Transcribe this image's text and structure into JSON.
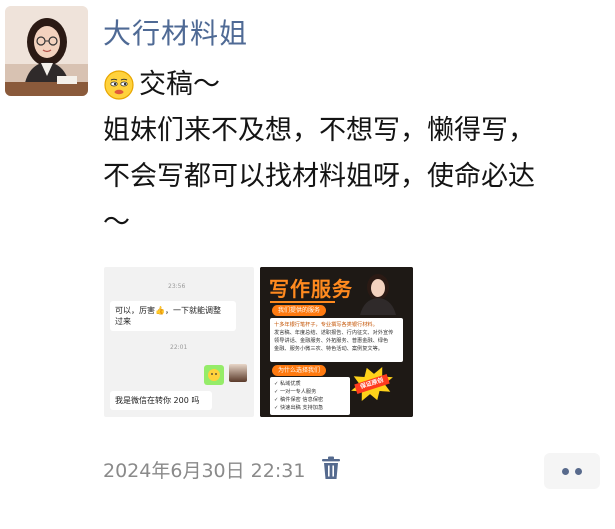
{
  "post": {
    "author": "大行材料姐",
    "line1_text": "交稿～",
    "line2_text": "姐妹们来不及想，不想写，懒得写，",
    "line3_text": "不会写都可以找材料姐呀，使命必达",
    "line4_text": "～",
    "timestamp": "2024年6月30日 22:31",
    "emoji_icon": "smirk-emoji"
  },
  "images": {
    "chat_screenshot": {
      "time1": "23:56",
      "message1_line1": "可以，厉害👍，一下就能调整",
      "message1_line2": "过来",
      "time2": "22:01",
      "message2": "我是微信在转你 200 吗"
    },
    "service_poster": {
      "title": "写作服务",
      "pill1": "我们提供的服务",
      "intro": "十多年银行笔杆子，专业撰写各类银行材料。",
      "services_line1": "发言稿、年度总结、述职报告、行内征文、对外宣传",
      "services_line2": "领导讲话、金融服务、外拓服务、普惠金融、绿色",
      "services_line3": "金融、服务小微三农、特色活动、案例复文等。",
      "pill2": "为什么选择我们",
      "reasons": [
        "✓ 私域优质",
        "✓ 一对一专人服务",
        "✓ 稿件保密 信息保密",
        "✓ 快速出稿 支持加急",
        "✓ 专业原创 实力保证"
      ],
      "badge_text": "保证原创"
    }
  },
  "colors": {
    "author": "#4f6a95",
    "accent_orange": "#ff8a1f",
    "wechat_green": "#95ec69",
    "meta_gray": "#8a8a8a"
  }
}
